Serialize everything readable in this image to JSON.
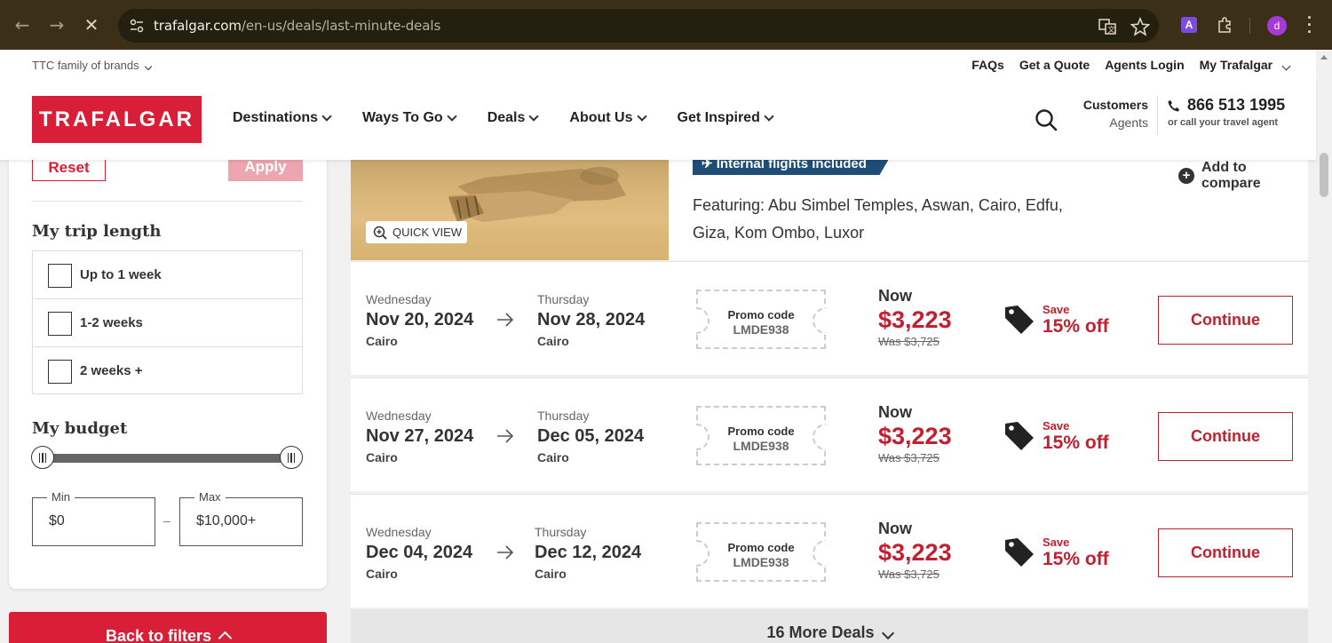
{
  "browser": {
    "url_domain": "trafalgar.com",
    "url_path": "/en-us/deals/last-minute-deals",
    "profile_initial": "d",
    "extension_letter": "A"
  },
  "header": {
    "ttc_label": "TTC family of brands",
    "top_links": [
      "FAQs",
      "Get a Quote",
      "Agents Login",
      "My Trafalgar"
    ],
    "logo": "TRAFALGAR",
    "menu": [
      "Destinations",
      "Ways To Go",
      "Deals",
      "About Us",
      "Get Inspired"
    ],
    "customers_label": "Customers",
    "agents_label": "Agents",
    "phone": "866 513 1995",
    "phone_sub": "or call your travel agent"
  },
  "filters": {
    "reset_label": "Reset",
    "apply_label": "Apply",
    "trip_length_heading": "My trip length",
    "trip_lengths": [
      "Up to 1 week",
      "1-2 weeks",
      "2 weeks +"
    ],
    "budget_heading": "My budget",
    "min_label": "Min",
    "min_value": "$0",
    "max_label": "Max",
    "max_value": "$10,000+",
    "separator": "–",
    "back_label": "Back to filters"
  },
  "tour": {
    "quick_view": "QUICK VIEW",
    "badge": "Internal flights included",
    "featuring": "Featuring: Abu Simbel Temples, Aswan, Cairo, Edfu, Giza, Kom Ombo, Luxor",
    "compare_label": "Add to compare"
  },
  "deals": [
    {
      "start_day": "Wednesday",
      "start_date": "Nov 20, 2024",
      "start_city": "Cairo",
      "end_day": "Thursday",
      "end_date": "Nov 28, 2024",
      "end_city": "Cairo",
      "promo_label": "Promo code",
      "promo_code": "LMDE938",
      "now_label": "Now",
      "price": "$3,223",
      "was": "Was $3,725",
      "save_label": "Save",
      "save_pct": "15% off",
      "cta": "Continue"
    },
    {
      "start_day": "Wednesday",
      "start_date": "Nov 27, 2024",
      "start_city": "Cairo",
      "end_day": "Thursday",
      "end_date": "Dec 05, 2024",
      "end_city": "Cairo",
      "promo_label": "Promo code",
      "promo_code": "LMDE938",
      "now_label": "Now",
      "price": "$3,223",
      "was": "Was $3,725",
      "save_label": "Save",
      "save_pct": "15% off",
      "cta": "Continue"
    },
    {
      "start_day": "Wednesday",
      "start_date": "Dec 04, 2024",
      "start_city": "Cairo",
      "end_day": "Thursday",
      "end_date": "Dec 12, 2024",
      "end_city": "Cairo",
      "promo_label": "Promo code",
      "promo_code": "LMDE938",
      "now_label": "Now",
      "price": "$3,223",
      "was": "Was $3,725",
      "save_label": "Save",
      "save_pct": "15% off",
      "cta": "Continue"
    }
  ],
  "more_deals": "16 More Deals",
  "colors": {
    "brand_red": "#d91f37",
    "price_red": "#c0202f",
    "badge_blue": "#1e4d78"
  }
}
